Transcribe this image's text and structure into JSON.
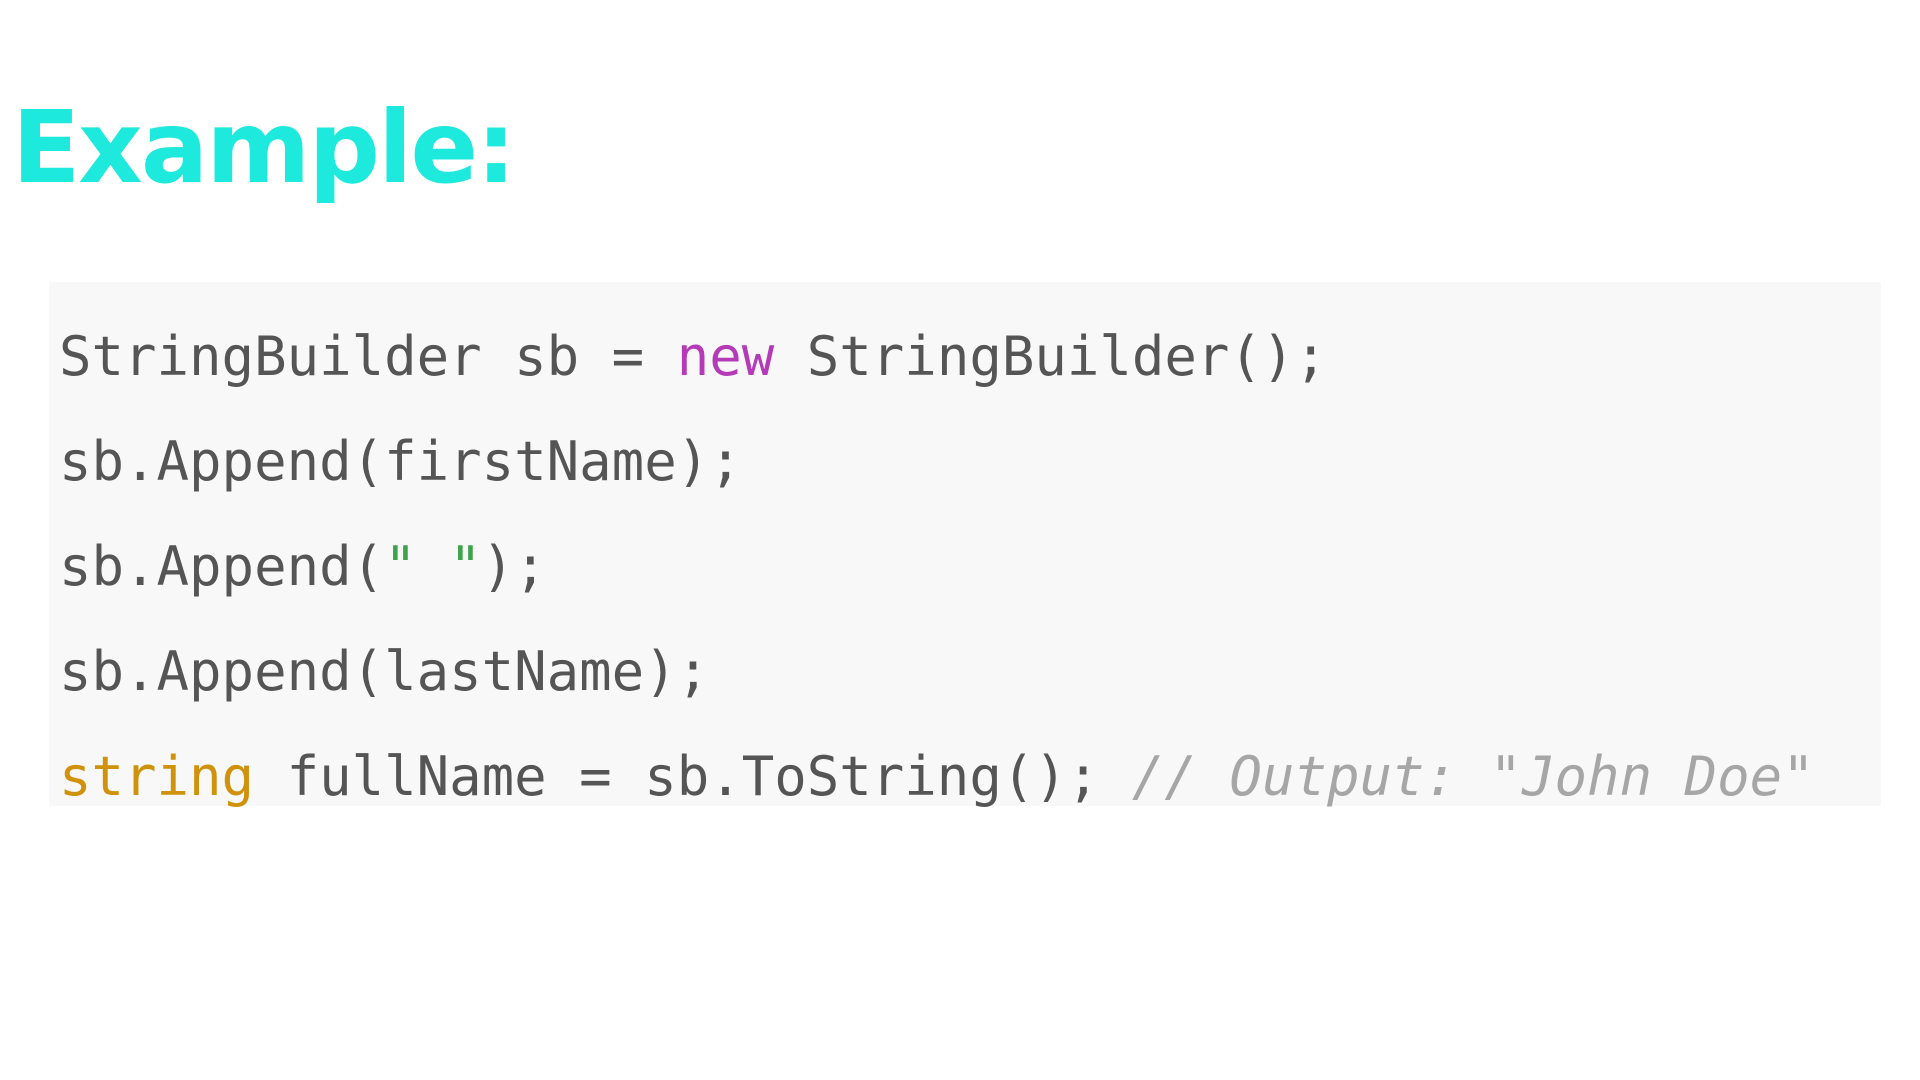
{
  "heading": "Example:",
  "colors": {
    "heading": "#1de9dc",
    "code_background": "#f8f8f8",
    "plain": "#555555",
    "keyword_new": "#b43ab8",
    "keyword_type": "#d0920a",
    "string": "#3ea34a",
    "comment": "#a6a6a6"
  },
  "code": {
    "language": "csharp",
    "lines": [
      [
        {
          "text": "StringBuilder sb = ",
          "kind": "plain"
        },
        {
          "text": "new",
          "kind": "keyword-new"
        },
        {
          "text": " StringBuilder();",
          "kind": "plain"
        }
      ],
      [
        {
          "text": "sb.Append(firstName);",
          "kind": "plain"
        }
      ],
      [
        {
          "text": "sb.Append(",
          "kind": "plain"
        },
        {
          "text": "\" \"",
          "kind": "string"
        },
        {
          "text": ");",
          "kind": "plain"
        }
      ],
      [
        {
          "text": "sb.Append(lastName);",
          "kind": "plain"
        }
      ],
      [
        {
          "text": "string",
          "kind": "keyword-type"
        },
        {
          "text": " fullName = sb.ToString(); ",
          "kind": "plain"
        },
        {
          "text": "// Output: \"John Doe\"",
          "kind": "comment"
        }
      ]
    ]
  }
}
